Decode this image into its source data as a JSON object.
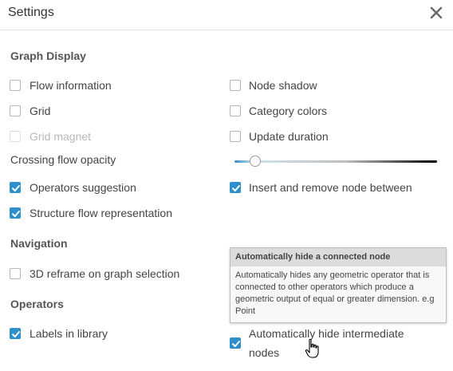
{
  "dialog": {
    "title": "Settings",
    "close_icon": "close-icon"
  },
  "sections": {
    "graph_display": "Graph Display",
    "navigation": "Navigation",
    "operators": "Operators"
  },
  "options": {
    "flow_information": {
      "label": "Flow information",
      "checked": false
    },
    "node_shadow": {
      "label": "Node shadow",
      "checked": false
    },
    "grid": {
      "label": "Grid",
      "checked": false
    },
    "category_colors": {
      "label": "Category colors",
      "checked": false
    },
    "grid_magnet": {
      "label": "Grid magnet",
      "checked": false,
      "disabled": true
    },
    "update_duration": {
      "label": "Update duration",
      "checked": false
    },
    "operators_suggestion": {
      "label": "Operators suggestion",
      "checked": true
    },
    "insert_remove_node": {
      "label": "Insert and remove node between",
      "checked": true
    },
    "structure_flow": {
      "label": "Structure flow representation",
      "checked": true
    },
    "reframe_3d": {
      "label": "3D reframe on graph selection",
      "checked": false
    },
    "labels_in_library": {
      "label": "Labels in library",
      "checked": true
    },
    "auto_hide_intermediate": {
      "label_line1": "Automatically hide intermediate",
      "label_line2": "nodes",
      "checked": true
    }
  },
  "crossing_flow_opacity": {
    "label": "Crossing flow opacity",
    "value": 0.08
  },
  "tooltip": {
    "title": "Automatically hide a connected node",
    "body": "Automatically hides any geometric operator that is connected to other operators which produce a geometric output of equal or greater dimension. e.g Point"
  },
  "colors": {
    "accent": "#2f8fcb",
    "text": "#444444",
    "disabled": "#b8b8b8"
  }
}
